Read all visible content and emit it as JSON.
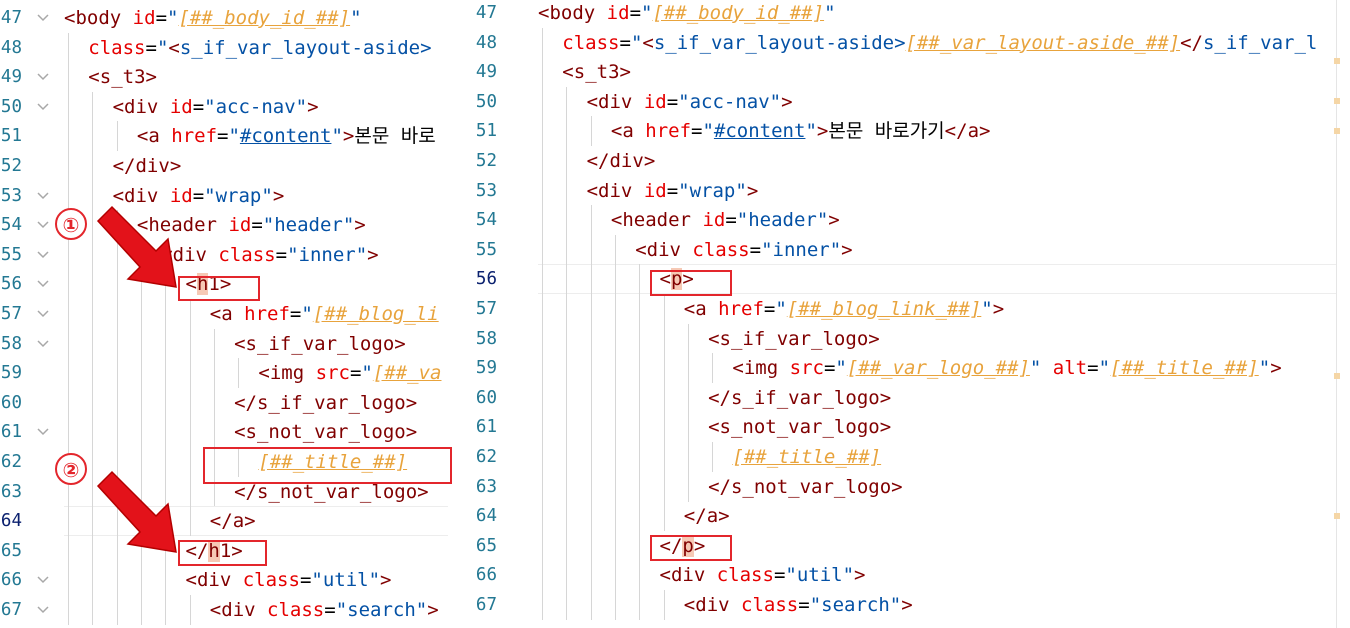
{
  "left_editor": {
    "lines": [
      {
        "n": "47",
        "fold": true,
        "indent": 0,
        "tokens": [
          [
            "pun",
            "<"
          ],
          [
            "tag",
            "body"
          ],
          [
            "txt",
            " "
          ],
          [
            "attr",
            "id"
          ],
          [
            "txt",
            "="
          ],
          [
            "str",
            "\""
          ],
          [
            "var",
            "[##_body_id_##]"
          ],
          [
            "str",
            "\""
          ]
        ]
      },
      {
        "n": "48",
        "fold": false,
        "indent": 1,
        "tokens": [
          [
            "attr",
            "class"
          ],
          [
            "txt",
            "="
          ],
          [
            "str",
            "\""
          ],
          [
            "pun",
            "<"
          ],
          [
            "str",
            "s_if_var_layout-aside>"
          ]
        ]
      },
      {
        "n": "49",
        "fold": true,
        "indent": 1,
        "tokens": [
          [
            "pun",
            "<"
          ],
          [
            "tag",
            "s_t3"
          ],
          [
            "pun",
            ">"
          ]
        ]
      },
      {
        "n": "50",
        "fold": true,
        "indent": 2,
        "tokens": [
          [
            "pun",
            "<"
          ],
          [
            "tag",
            "div"
          ],
          [
            "txt",
            " "
          ],
          [
            "attr",
            "id"
          ],
          [
            "txt",
            "="
          ],
          [
            "str",
            "\"acc-nav\""
          ],
          [
            "pun",
            ">"
          ]
        ]
      },
      {
        "n": "51",
        "fold": false,
        "indent": 3,
        "tokens": [
          [
            "pun",
            "<"
          ],
          [
            "tag",
            "a"
          ],
          [
            "txt",
            " "
          ],
          [
            "attr",
            "href"
          ],
          [
            "txt",
            "="
          ],
          [
            "str",
            "\""
          ],
          [
            "link",
            "#content"
          ],
          [
            "str",
            "\""
          ],
          [
            "pun",
            ">"
          ],
          [
            "txt",
            "본문 바로"
          ]
        ]
      },
      {
        "n": "52",
        "fold": false,
        "indent": 2,
        "tokens": [
          [
            "pun",
            "</"
          ],
          [
            "tag",
            "div"
          ],
          [
            "pun",
            ">"
          ]
        ]
      },
      {
        "n": "53",
        "fold": true,
        "indent": 2,
        "tokens": [
          [
            "pun",
            "<"
          ],
          [
            "tag",
            "div"
          ],
          [
            "txt",
            " "
          ],
          [
            "attr",
            "id"
          ],
          [
            "txt",
            "="
          ],
          [
            "str",
            "\"wrap\""
          ],
          [
            "pun",
            ">"
          ]
        ]
      },
      {
        "n": "54",
        "fold": true,
        "indent": 3,
        "tokens": [
          [
            "pun",
            "<"
          ],
          [
            "tag",
            "header"
          ],
          [
            "txt",
            " "
          ],
          [
            "attr",
            "id"
          ],
          [
            "txt",
            "="
          ],
          [
            "str",
            "\"header\""
          ],
          [
            "pun",
            ">"
          ]
        ]
      },
      {
        "n": "55",
        "fold": true,
        "indent": 4,
        "tokens": [
          [
            "pun",
            "<"
          ],
          [
            "tag",
            "div"
          ],
          [
            "txt",
            " "
          ],
          [
            "attr",
            "class"
          ],
          [
            "txt",
            "="
          ],
          [
            "str",
            "\"inner\""
          ],
          [
            "pun",
            ">"
          ]
        ]
      },
      {
        "n": "56",
        "fold": true,
        "indent": 5,
        "tokens": [
          [
            "pun",
            "<"
          ],
          [
            "hl",
            "h"
          ],
          [
            "tag",
            "1"
          ],
          [
            "pun",
            ">"
          ]
        ]
      },
      {
        "n": "57",
        "fold": true,
        "indent": 6,
        "tokens": [
          [
            "pun",
            "<"
          ],
          [
            "tag",
            "a"
          ],
          [
            "txt",
            " "
          ],
          [
            "attr",
            "href"
          ],
          [
            "txt",
            "="
          ],
          [
            "str",
            "\""
          ],
          [
            "var",
            "[##_blog_li"
          ]
        ]
      },
      {
        "n": "58",
        "fold": true,
        "indent": 7,
        "tokens": [
          [
            "pun",
            "<"
          ],
          [
            "tag",
            "s_if_var_logo"
          ],
          [
            "pun",
            ">"
          ]
        ]
      },
      {
        "n": "59",
        "fold": false,
        "indent": 8,
        "tokens": [
          [
            "pun",
            "<"
          ],
          [
            "tag",
            "img"
          ],
          [
            "txt",
            " "
          ],
          [
            "attr",
            "src"
          ],
          [
            "txt",
            "="
          ],
          [
            "str",
            "\""
          ],
          [
            "var",
            "[##_va"
          ]
        ]
      },
      {
        "n": "60",
        "fold": false,
        "indent": 7,
        "tokens": [
          [
            "pun",
            "</"
          ],
          [
            "tag",
            "s_if_var_logo"
          ],
          [
            "pun",
            ">"
          ]
        ]
      },
      {
        "n": "61",
        "fold": true,
        "indent": 7,
        "tokens": [
          [
            "pun",
            "<"
          ],
          [
            "tag",
            "s_not_var_logo"
          ],
          [
            "pun",
            ">"
          ]
        ]
      },
      {
        "n": "62",
        "fold": false,
        "indent": 8,
        "tokens": [
          [
            "var",
            "[##_title_##]"
          ]
        ]
      },
      {
        "n": "63",
        "fold": false,
        "indent": 7,
        "tokens": [
          [
            "pun",
            "</"
          ],
          [
            "tag",
            "s_not_var_logo"
          ],
          [
            "pun",
            ">"
          ]
        ]
      },
      {
        "n": "64",
        "fold": false,
        "indent": 6,
        "active": true,
        "tokens": [
          [
            "pun",
            "</"
          ],
          [
            "tag",
            "a"
          ],
          [
            "pun",
            ">"
          ]
        ]
      },
      {
        "n": "65",
        "fold": false,
        "indent": 5,
        "tokens": [
          [
            "pun",
            "</"
          ],
          [
            "hl",
            "h"
          ],
          [
            "tag",
            "1"
          ],
          [
            "pun",
            ">"
          ]
        ]
      },
      {
        "n": "66",
        "fold": true,
        "indent": 5,
        "tokens": [
          [
            "pun",
            "<"
          ],
          [
            "tag",
            "div"
          ],
          [
            "txt",
            " "
          ],
          [
            "attr",
            "class"
          ],
          [
            "txt",
            "="
          ],
          [
            "str",
            "\"util\""
          ],
          [
            "pun",
            ">"
          ]
        ]
      },
      {
        "n": "67",
        "fold": true,
        "indent": 6,
        "tokens": [
          [
            "pun",
            "<"
          ],
          [
            "tag",
            "div"
          ],
          [
            "txt",
            " "
          ],
          [
            "attr",
            "class"
          ],
          [
            "txt",
            "="
          ],
          [
            "str",
            "\"search\""
          ],
          [
            "pun",
            ">"
          ]
        ]
      }
    ]
  },
  "right_editor": {
    "lines": [
      {
        "n": "47",
        "indent": 0,
        "tokens": [
          [
            "pun",
            "<"
          ],
          [
            "tag",
            "body"
          ],
          [
            "txt",
            " "
          ],
          [
            "attr",
            "id"
          ],
          [
            "txt",
            "="
          ],
          [
            "str",
            "\""
          ],
          [
            "var",
            "[##_body_id_##]"
          ],
          [
            "str",
            "\""
          ]
        ]
      },
      {
        "n": "48",
        "indent": 1,
        "tokens": [
          [
            "attr",
            "class"
          ],
          [
            "txt",
            "="
          ],
          [
            "str",
            "\""
          ],
          [
            "pun",
            "<"
          ],
          [
            "str",
            "s_if_var_layout-aside>"
          ],
          [
            "var",
            "[##_var_layout-aside_##]"
          ],
          [
            "pun",
            "</"
          ],
          [
            "str",
            "s_if_var_l"
          ]
        ]
      },
      {
        "n": "49",
        "indent": 1,
        "tokens": [
          [
            "pun",
            "<"
          ],
          [
            "tag",
            "s_t3"
          ],
          [
            "pun",
            ">"
          ]
        ]
      },
      {
        "n": "50",
        "indent": 2,
        "tokens": [
          [
            "pun",
            "<"
          ],
          [
            "tag",
            "div"
          ],
          [
            "txt",
            " "
          ],
          [
            "attr",
            "id"
          ],
          [
            "txt",
            "="
          ],
          [
            "str",
            "\"acc-nav\""
          ],
          [
            "pun",
            ">"
          ]
        ]
      },
      {
        "n": "51",
        "indent": 3,
        "tokens": [
          [
            "pun",
            "<"
          ],
          [
            "tag",
            "a"
          ],
          [
            "txt",
            " "
          ],
          [
            "attr",
            "href"
          ],
          [
            "txt",
            "="
          ],
          [
            "str",
            "\""
          ],
          [
            "link",
            "#content"
          ],
          [
            "str",
            "\""
          ],
          [
            "pun",
            ">"
          ],
          [
            "txt",
            "본문 바로가기"
          ],
          [
            "pun",
            "</"
          ],
          [
            "tag",
            "a"
          ],
          [
            "pun",
            ">"
          ]
        ]
      },
      {
        "n": "52",
        "indent": 2,
        "tokens": [
          [
            "pun",
            "</"
          ],
          [
            "tag",
            "div"
          ],
          [
            "pun",
            ">"
          ]
        ]
      },
      {
        "n": "53",
        "indent": 2,
        "tokens": [
          [
            "pun",
            "<"
          ],
          [
            "tag",
            "div"
          ],
          [
            "txt",
            " "
          ],
          [
            "attr",
            "id"
          ],
          [
            "txt",
            "="
          ],
          [
            "str",
            "\"wrap\""
          ],
          [
            "pun",
            ">"
          ]
        ]
      },
      {
        "n": "54",
        "indent": 3,
        "tokens": [
          [
            "pun",
            "<"
          ],
          [
            "tag",
            "header"
          ],
          [
            "txt",
            " "
          ],
          [
            "attr",
            "id"
          ],
          [
            "txt",
            "="
          ],
          [
            "str",
            "\"header\""
          ],
          [
            "pun",
            ">"
          ]
        ]
      },
      {
        "n": "55",
        "indent": 4,
        "tokens": [
          [
            "pun",
            "<"
          ],
          [
            "tag",
            "div"
          ],
          [
            "txt",
            " "
          ],
          [
            "attr",
            "class"
          ],
          [
            "txt",
            "="
          ],
          [
            "str",
            "\"inner\""
          ],
          [
            "pun",
            ">"
          ]
        ]
      },
      {
        "n": "56",
        "indent": 5,
        "active": true,
        "tokens": [
          [
            "pun",
            "<"
          ],
          [
            "hl",
            "p"
          ],
          [
            "pun",
            ">"
          ]
        ]
      },
      {
        "n": "57",
        "indent": 6,
        "tokens": [
          [
            "pun",
            "<"
          ],
          [
            "tag",
            "a"
          ],
          [
            "txt",
            " "
          ],
          [
            "attr",
            "href"
          ],
          [
            "txt",
            "="
          ],
          [
            "str",
            "\""
          ],
          [
            "var",
            "[##_blog_link_##]"
          ],
          [
            "str",
            "\""
          ],
          [
            "pun",
            ">"
          ]
        ]
      },
      {
        "n": "58",
        "indent": 7,
        "tokens": [
          [
            "pun",
            "<"
          ],
          [
            "tag",
            "s_if_var_logo"
          ],
          [
            "pun",
            ">"
          ]
        ]
      },
      {
        "n": "59",
        "indent": 8,
        "tokens": [
          [
            "pun",
            "<"
          ],
          [
            "tag",
            "img"
          ],
          [
            "txt",
            " "
          ],
          [
            "attr",
            "src"
          ],
          [
            "txt",
            "="
          ],
          [
            "str",
            "\""
          ],
          [
            "var",
            "[##_var_logo_##]"
          ],
          [
            "str",
            "\""
          ],
          [
            "txt",
            " "
          ],
          [
            "attr",
            "alt"
          ],
          [
            "txt",
            "="
          ],
          [
            "str",
            "\""
          ],
          [
            "var",
            "[##_title_##]"
          ],
          [
            "str",
            "\""
          ],
          [
            "pun",
            ">"
          ]
        ]
      },
      {
        "n": "60",
        "indent": 7,
        "tokens": [
          [
            "pun",
            "</"
          ],
          [
            "tag",
            "s_if_var_logo"
          ],
          [
            "pun",
            ">"
          ]
        ]
      },
      {
        "n": "61",
        "indent": 7,
        "tokens": [
          [
            "pun",
            "<"
          ],
          [
            "tag",
            "s_not_var_logo"
          ],
          [
            "pun",
            ">"
          ]
        ]
      },
      {
        "n": "62",
        "indent": 8,
        "tokens": [
          [
            "var",
            "[##_title_##]"
          ]
        ]
      },
      {
        "n": "63",
        "indent": 7,
        "tokens": [
          [
            "pun",
            "</"
          ],
          [
            "tag",
            "s_not_var_logo"
          ],
          [
            "pun",
            ">"
          ]
        ]
      },
      {
        "n": "64",
        "indent": 6,
        "tokens": [
          [
            "pun",
            "</"
          ],
          [
            "tag",
            "a"
          ],
          [
            "pun",
            ">"
          ]
        ]
      },
      {
        "n": "65",
        "indent": 5,
        "tokens": [
          [
            "pun",
            "</"
          ],
          [
            "hl",
            "p"
          ],
          [
            "pun",
            ">"
          ]
        ]
      },
      {
        "n": "66",
        "indent": 5,
        "tokens": [
          [
            "pun",
            "<"
          ],
          [
            "tag",
            "div"
          ],
          [
            "txt",
            " "
          ],
          [
            "attr",
            "class"
          ],
          [
            "txt",
            "="
          ],
          [
            "str",
            "\"util\""
          ],
          [
            "pun",
            ">"
          ]
        ]
      },
      {
        "n": "67",
        "indent": 6,
        "tokens": [
          [
            "pun",
            "<"
          ],
          [
            "tag",
            "div"
          ],
          [
            "txt",
            " "
          ],
          [
            "attr",
            "class"
          ],
          [
            "txt",
            "="
          ],
          [
            "str",
            "\"search\""
          ],
          [
            "pun",
            ">"
          ]
        ]
      }
    ]
  },
  "annotations": {
    "badge_1": "①",
    "badge_2": "②",
    "accent_color": "#e3262c"
  }
}
